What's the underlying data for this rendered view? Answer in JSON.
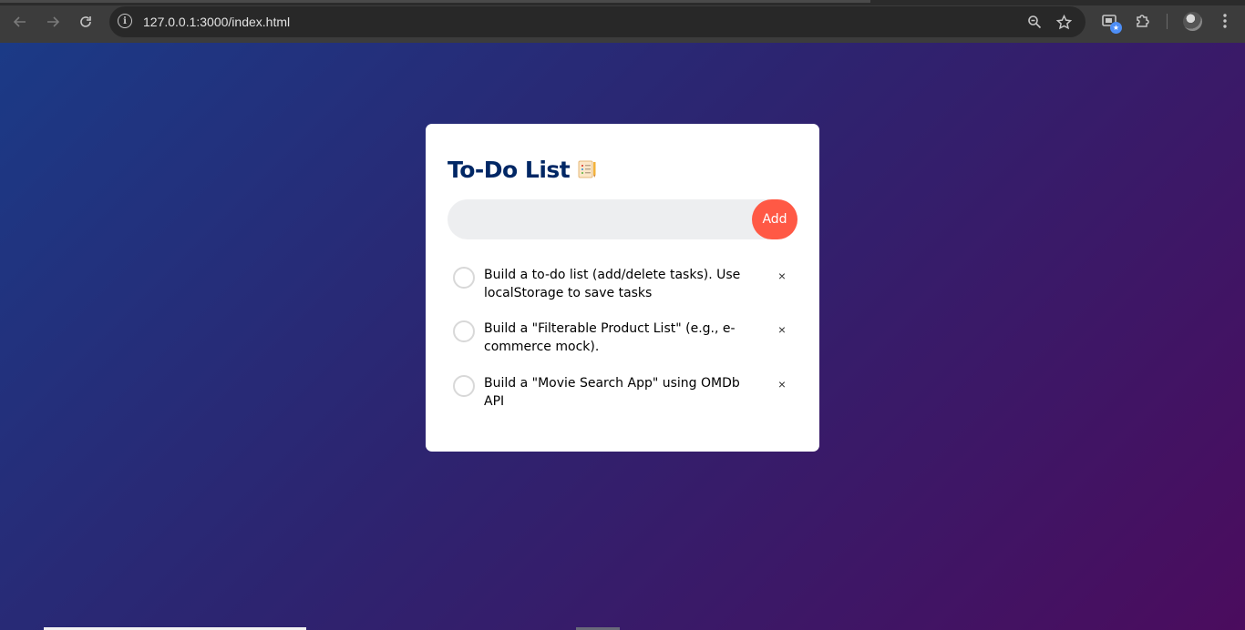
{
  "browser": {
    "url": "127.0.0.1:3000/index.html",
    "icons": {
      "back": "arrow-left-icon",
      "forward": "arrow-right-icon",
      "reload": "reload-icon",
      "site_info": "info-icon",
      "zoom": "zoom-icon",
      "bookmark": "star-icon",
      "extension_badge": "cast-icon",
      "extensions": "puzzle-icon",
      "profile": "avatar",
      "menu": "kebab-menu-icon"
    }
  },
  "app": {
    "title": "To-Do List",
    "title_icon": "notepad-icon",
    "input": {
      "value": "",
      "placeholder": ""
    },
    "add_label": "Add",
    "tasks": [
      {
        "text": "Build a to-do list (add/delete tasks). Use localStorage to save tasks",
        "checked": false,
        "delete_label": "×"
      },
      {
        "text": "Build a \"Filterable Product List\" (e.g., e-commerce mock).",
        "checked": false,
        "delete_label": "×"
      },
      {
        "text": "Build a \"Movie Search App\" using OMDb API",
        "checked": false,
        "delete_label": "×"
      }
    ]
  },
  "colors": {
    "title": "#002765",
    "add_button": "#ff5945",
    "input_bg": "#edeef0",
    "gradient_start": "#1b3a86",
    "gradient_end": "#4b0c5e"
  }
}
